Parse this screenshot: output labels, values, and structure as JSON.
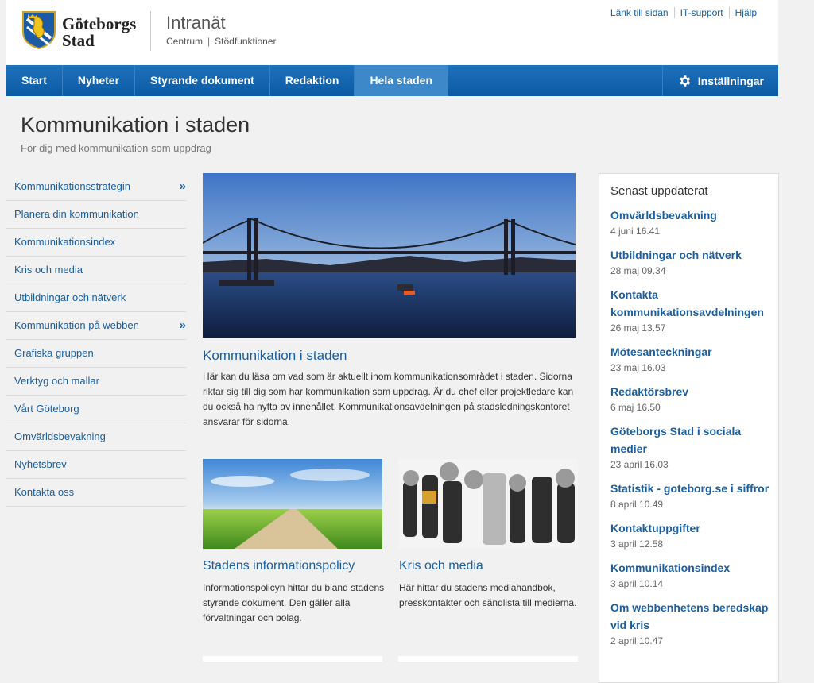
{
  "header": {
    "brand_line1": "Göteborgs",
    "brand_line2": "Stad",
    "site_title": "Intranät",
    "crumb1": "Centrum",
    "crumb_sep": "|",
    "crumb2": "Stödfunktioner",
    "util_links": [
      "Länk till sidan",
      "IT-support",
      "Hjälp"
    ]
  },
  "nav": {
    "items": [
      "Start",
      "Nyheter",
      "Styrande dokument",
      "Redaktion",
      "Hela staden"
    ],
    "active": "Hela staden",
    "settings_label": "Inställningar",
    "settings_icon": "gear-icon"
  },
  "page": {
    "title": "Kommunikation i staden",
    "subtitle": "För dig med kommunikation som uppdrag"
  },
  "leftnav": {
    "items": [
      {
        "label": "Kommunikationsstrategin",
        "chevron": "»"
      },
      {
        "label": "Planera din kommunikation"
      },
      {
        "label": "Kommunikationsindex"
      },
      {
        "label": "Kris och media"
      },
      {
        "label": "Utbildningar och nätverk"
      },
      {
        "label": "Kommunikation på webben",
        "chevron": "»"
      },
      {
        "label": "Grafiska gruppen"
      },
      {
        "label": "Verktyg och mallar"
      },
      {
        "label": "Vårt Göteborg"
      },
      {
        "label": "Omvärldsbevakning"
      },
      {
        "label": "Nyhetsbrev"
      },
      {
        "label": "Kontakta oss"
      }
    ]
  },
  "main": {
    "hero_title": "Kommunikation i staden",
    "hero_text": "Här kan du läsa om vad som är aktuellt inom kommunikationsområdet i staden. Sidorna riktar sig till dig som har kommunikation som uppdrag. Är du chef eller projektledare kan du också ha nytta av innehållet. Kommunikationsavdelningen på stadsledningskontoret ansvarar för sidorna.",
    "cards": [
      {
        "title": "Stadens informationspolicy",
        "text": "Informationspolicyn hittar du bland stadens styrande dokument. Den gäller alla förvaltningar och bolag."
      },
      {
        "title": "Kris och media",
        "text": "Här hittar du stadens mediahandbok, presskontakter och sändlista till medierna."
      }
    ]
  },
  "sidebar": {
    "heading": "Senast uppdaterat",
    "items": [
      {
        "title": "Omvärldsbevakning",
        "date": "4 juni 16.41"
      },
      {
        "title": "Utbildningar och nätverk",
        "date": "28 maj 09.34"
      },
      {
        "title": "Kontakta kommunikationsavdelningen",
        "date": "26 maj 13.57"
      },
      {
        "title": "Mötesanteckningar",
        "date": "23 maj 16.03"
      },
      {
        "title": "Redaktörsbrev",
        "date": "6 maj 16.50"
      },
      {
        "title": "Göteborgs Stad i sociala medier",
        "date": "23 april 16.03"
      },
      {
        "title": "Statistik - goteborg.se i siffror",
        "date": "8 april 10.49"
      },
      {
        "title": "Kontaktuppgifter",
        "date": "3 april 12.58"
      },
      {
        "title": "Kommunikationsindex",
        "date": "3 april 10.14"
      },
      {
        "title": "Om webbenhetens beredskap vid kris",
        "date": "2 april 10.47"
      }
    ]
  },
  "colors": {
    "nav_blue": "#0b59a3",
    "nav_active": "#3d88c8",
    "link_blue": "#1a5fa0",
    "background": "#f1f1f2"
  }
}
